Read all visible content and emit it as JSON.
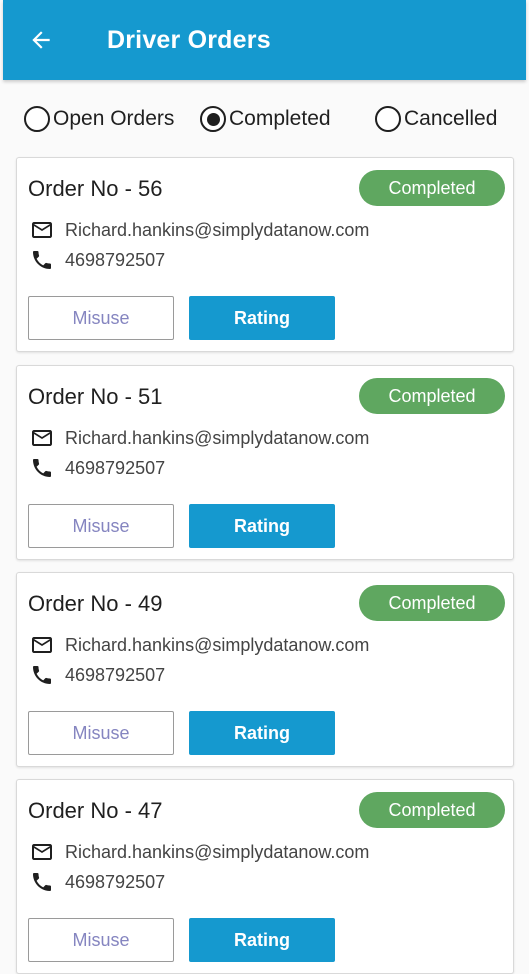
{
  "header": {
    "title": "Driver Orders",
    "back_icon": "arrow-left-icon",
    "background_color": "#1599cf"
  },
  "filters": {
    "options": [
      {
        "label": "Open Orders",
        "selected": false
      },
      {
        "label": "Completed",
        "selected": true
      },
      {
        "label": "Cancelled",
        "selected": false
      }
    ]
  },
  "orders": [
    {
      "title": "Order No - 56",
      "status": "Completed",
      "email": "Richard.hankins@simplydatanow.com",
      "phone": "4698792507",
      "misuse_label": "Misuse",
      "rating_label": "Rating"
    },
    {
      "title": "Order No - 51",
      "status": "Completed",
      "email": "Richard.hankins@simplydatanow.com",
      "phone": "4698792507",
      "misuse_label": "Misuse",
      "rating_label": "Rating"
    },
    {
      "title": "Order No - 49",
      "status": "Completed",
      "email": "Richard.hankins@simplydatanow.com",
      "phone": "4698792507",
      "misuse_label": "Misuse",
      "rating_label": "Rating"
    },
    {
      "title": "Order No - 47",
      "status": "Completed",
      "email": "Richard.hankins@simplydatanow.com",
      "phone": "4698792507",
      "misuse_label": "Misuse",
      "rating_label": "Rating"
    }
  ],
  "colors": {
    "status_completed": "#5fa760",
    "primary": "#1599cf",
    "misuse_text": "#8585c0"
  }
}
